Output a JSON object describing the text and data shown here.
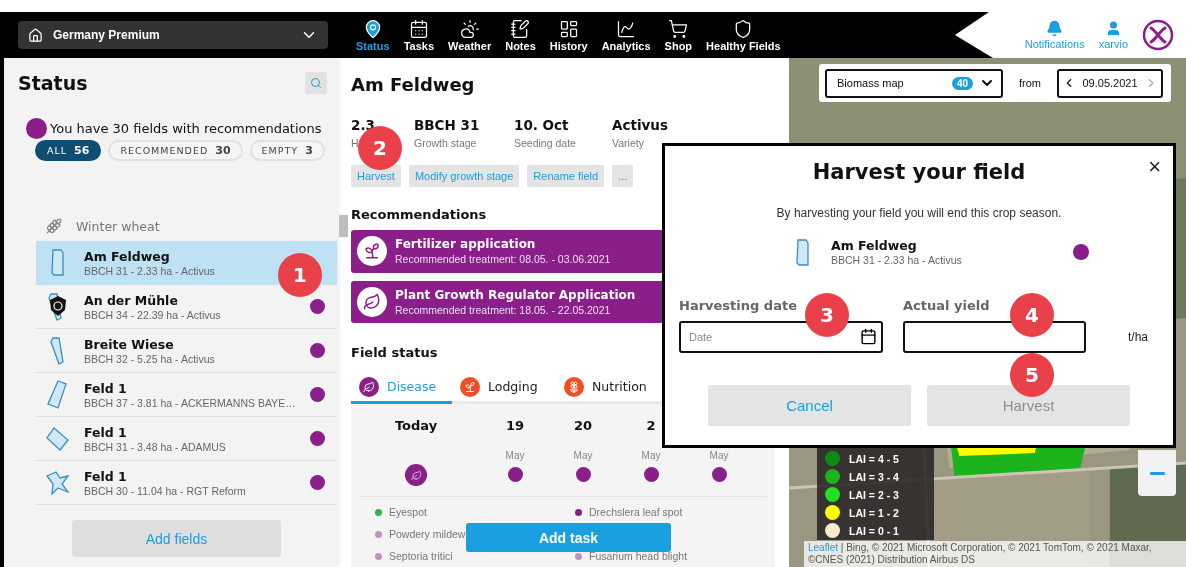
{
  "header": {
    "farm": "Germany Premium",
    "nav": [
      {
        "label": "Status",
        "selected": true
      },
      {
        "label": "Tasks",
        "selected": false
      },
      {
        "label": "Weather",
        "selected": false
      },
      {
        "label": "Notes",
        "selected": false
      },
      {
        "label": "History",
        "selected": false
      },
      {
        "label": "Analytics",
        "selected": false
      },
      {
        "label": "Shop",
        "selected": false
      },
      {
        "label": "Healthy Fields",
        "selected": false
      }
    ],
    "notifications": "Notifications",
    "user": "xarvio"
  },
  "status_panel": {
    "title": "Status",
    "summary": "You have 30 fields with recommendations",
    "filters": [
      {
        "label": "ALL",
        "count": "56",
        "selected": true
      },
      {
        "label": "RECOMMENDED",
        "count": "30",
        "selected": false
      },
      {
        "label": "EMPTY",
        "count": "3",
        "selected": false
      }
    ],
    "group": "Winter wheat",
    "fields": [
      {
        "name": "Am Feldweg",
        "detail": "BBCH 31 - 2.33 ha - Activus",
        "selected": true,
        "recommended": false
      },
      {
        "name": "An der Mühle",
        "detail": "BBCH 34 - 22.39 ha - Activus",
        "selected": false,
        "recommended": true
      },
      {
        "name": "Breite Wiese",
        "detail": "BBCH 32 - 5.25 ha - Activus",
        "selected": false,
        "recommended": true
      },
      {
        "name": "Feld 1",
        "detail": "BBCH 37 - 3.81 ha - ACKERMANNS BAYE…",
        "selected": false,
        "recommended": true
      },
      {
        "name": "Feld 1",
        "detail": "BBCH 31 - 3.48 ha - ADAMUS",
        "selected": false,
        "recommended": true
      },
      {
        "name": "Feld 1",
        "detail": "BBCH 30 - 11.04 ha - RGT Reform",
        "selected": false,
        "recommended": true
      }
    ],
    "add_button": "Add fields"
  },
  "field": {
    "title": "Am Feldweg",
    "stats": [
      {
        "value": "2.3",
        "label": "H"
      },
      {
        "value": "BBCH 31",
        "label": "Growth stage"
      },
      {
        "value": "10. Oct",
        "label": "Seeding date"
      },
      {
        "value": "Activus",
        "label": "Variety"
      }
    ],
    "actions": [
      "Harvest",
      "Modify growth stage",
      "Rename field",
      "..."
    ],
    "recommendations_title": "Recommendations",
    "recommendations": [
      {
        "title": "Fertilizer application",
        "detail": "Recommended treatment: 08.05. - 03.06.2021"
      },
      {
        "title": "Plant Growth Regulator Application",
        "detail": "Recommended treatment: 18.05. - 22.05.2021"
      }
    ],
    "status_title": "Field status",
    "tabs": [
      {
        "label": "Disease",
        "color": "#8a1f8a",
        "selected": true
      },
      {
        "label": "Lodging",
        "color": "#f04e23",
        "selected": false
      },
      {
        "label": "Nutrition",
        "color": "#f04e23",
        "selected": false
      }
    ],
    "days": [
      {
        "day": "Today",
        "selected": true
      },
      {
        "day": "19",
        "month": "May",
        "selected": false
      },
      {
        "day": "20",
        "month": "May",
        "selected": false
      },
      {
        "day": "2",
        "month": "May",
        "selected": false
      },
      {
        "month": "May",
        "selected": false
      }
    ],
    "diseases": [
      {
        "label": "Eyespot",
        "color": "#2db34a"
      },
      {
        "label": "Powdery mildew",
        "color": "#c58ec5"
      },
      {
        "label": "Septoria tritici",
        "color": "#c58ec5"
      },
      {
        "label": "Drechslera leaf spot",
        "color": "#8a1f8a"
      },
      {
        "label": "Fusarium head blight",
        "color": "#c58ec5"
      }
    ],
    "add_task": "Add task"
  },
  "map": {
    "layer": "Biomass map",
    "layer_count": "40",
    "from": "from",
    "date": "09.05.2021",
    "legend": [
      {
        "label": "LAI = 4 - 5",
        "color": "#0b8c16"
      },
      {
        "label": "LAI = 3 - 4",
        "color": "#1cb41c"
      },
      {
        "label": "LAI = 2 - 3",
        "color": "#22e022"
      },
      {
        "label": "LAI = 1 - 2",
        "color": "#ffff00"
      },
      {
        "label": "LAI = 0 - 1",
        "color": "#f6ead0"
      }
    ],
    "attribution_link": "Leaflet",
    "attribution": " | Bing, © 2021 Microsoft Corporation, © 2021 TomTom, © 2021 Maxar, ©CNES (2021) Distribution Airbus DS"
  },
  "dialog": {
    "title": "Harvest your field",
    "close": "×",
    "text": "By harvesting your field you will end this crop season.",
    "field": {
      "name": "Am Feldweg",
      "detail": "BBCH 31 - 2.33 ha - Activus",
      "recommended": true
    },
    "date_label": "Harvesting date",
    "date_placeholder": "Date",
    "yield_label": "Actual yield",
    "yield_unit": "t/ha",
    "cancel": "Cancel",
    "confirm": {
      "label": "Harvest",
      "disabled": true
    }
  },
  "annotations": [
    "1",
    "2",
    "3",
    "4",
    "5"
  ]
}
